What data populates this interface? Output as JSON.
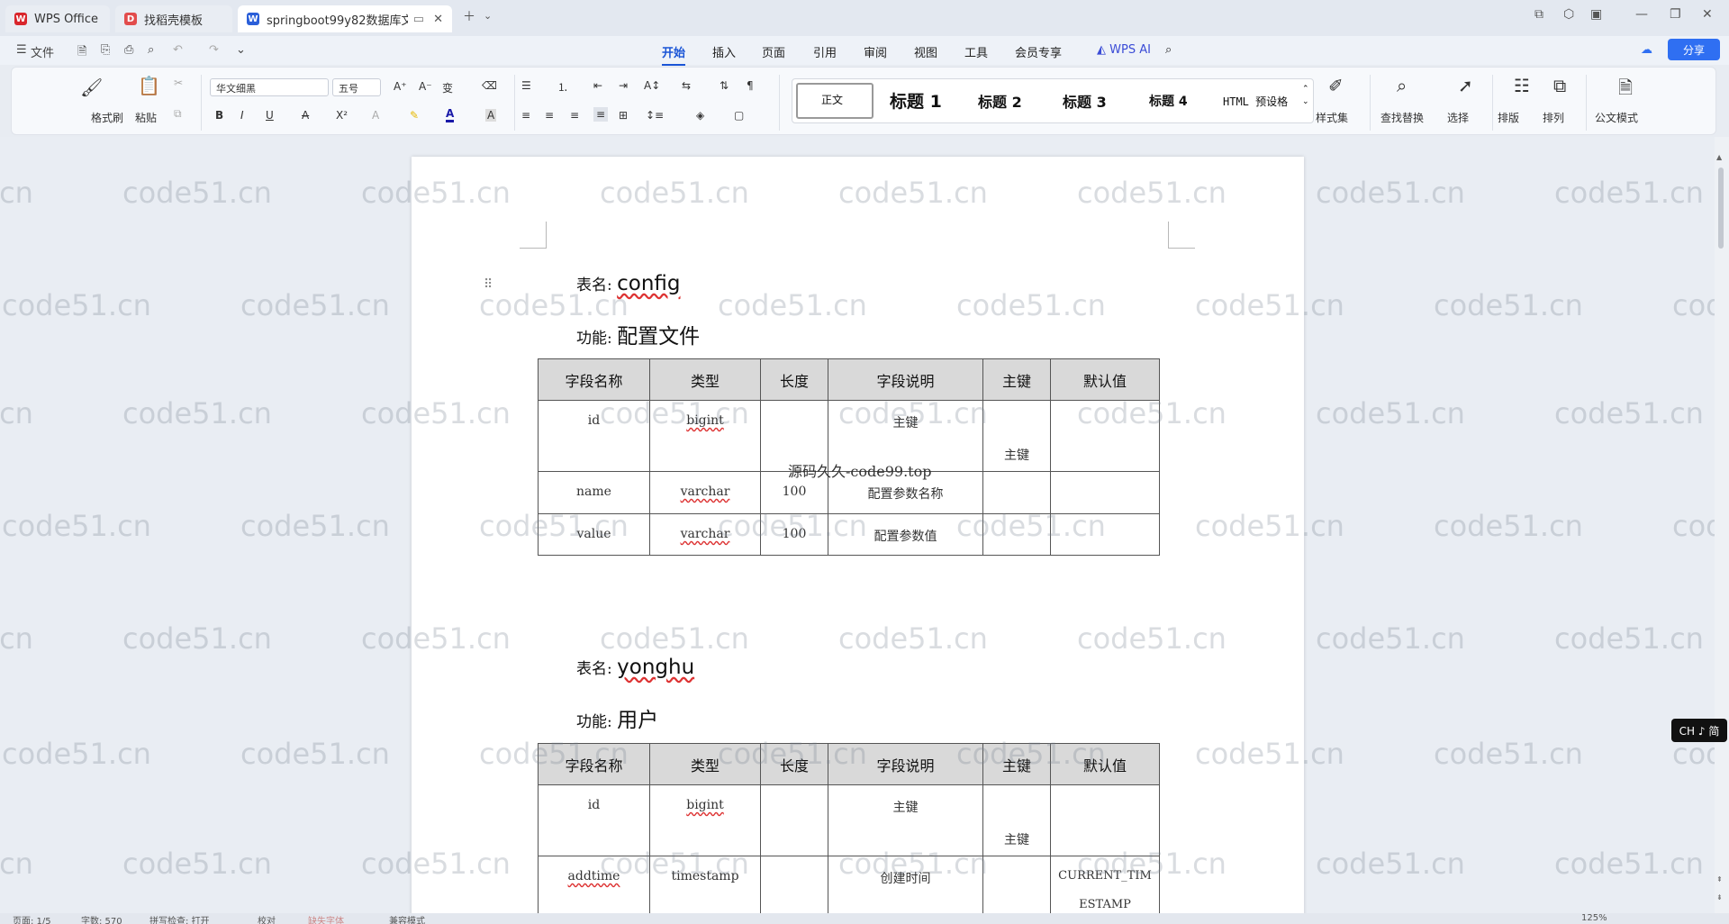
{
  "tabs": [
    {
      "label": "WPS Office",
      "icon": "wps-logo-icon",
      "color": "#d9262c"
    },
    {
      "label": "找稻壳模板",
      "icon": "docer-icon",
      "color": "#e24c4c"
    },
    {
      "label": "springboot99y82数据库文",
      "icon": "word-doc-icon",
      "color": "#2b5fd9"
    }
  ],
  "quickbar": {
    "file_label": "文件"
  },
  "menu": [
    "开始",
    "插入",
    "页面",
    "引用",
    "审阅",
    "视图",
    "工具",
    "会员专享"
  ],
  "menu_active": "开始",
  "wps_ai_label": "WPS AI",
  "share_label": "分享",
  "ribbon": {
    "format_painter": "格式刷",
    "paste": "粘贴",
    "font_name": "华文细黑",
    "font_size": "五号",
    "styles": [
      "正文",
      "标题 1",
      "标题 2",
      "标题 3",
      "标题 4",
      "HTML 预设格"
    ],
    "style_set": "样式集",
    "find_replace": "查找替换",
    "select": "选择",
    "typeset": "排版",
    "arrange": "排列",
    "official_mode": "公文模式"
  },
  "document": {
    "sections": [
      {
        "table_label": "表名:",
        "table_name": "config",
        "func_label": "功能:",
        "func_name": "配置文件",
        "headers": [
          "字段名称",
          "类型",
          "长度",
          "字段说明",
          "主键",
          "默认值"
        ],
        "rows": [
          [
            "id",
            "bigint",
            "",
            "主键",
            "主键",
            ""
          ],
          [
            "name",
            "varchar",
            "100",
            "配置参数名称",
            "",
            ""
          ],
          [
            "value",
            "varchar",
            "100",
            "配置参数值",
            "",
            ""
          ]
        ]
      },
      {
        "table_label": "表名:",
        "table_name": "yonghu",
        "func_label": "功能:",
        "func_name": "用户",
        "headers": [
          "字段名称",
          "类型",
          "长度",
          "字段说明",
          "主键",
          "默认值"
        ],
        "rows": [
          [
            "id",
            "bigint",
            "",
            "主键",
            "主键",
            ""
          ],
          [
            "addtime",
            "timestamp",
            "",
            "创建时间",
            "",
            "CURRENT_TIM ESTAMP"
          ]
        ]
      }
    ],
    "overlay_text": "源码久久-code99.top",
    "watermark": "code51.cn"
  },
  "ime_badge": "CH ♪ 简",
  "statusbar": {
    "page": "页面: 1/5",
    "words": "字数: 570",
    "spell": "拼写检查: 打开",
    "proof": "校对",
    "missing_font": "缺失字体",
    "compat": "兼容模式",
    "zoom": "125%"
  }
}
